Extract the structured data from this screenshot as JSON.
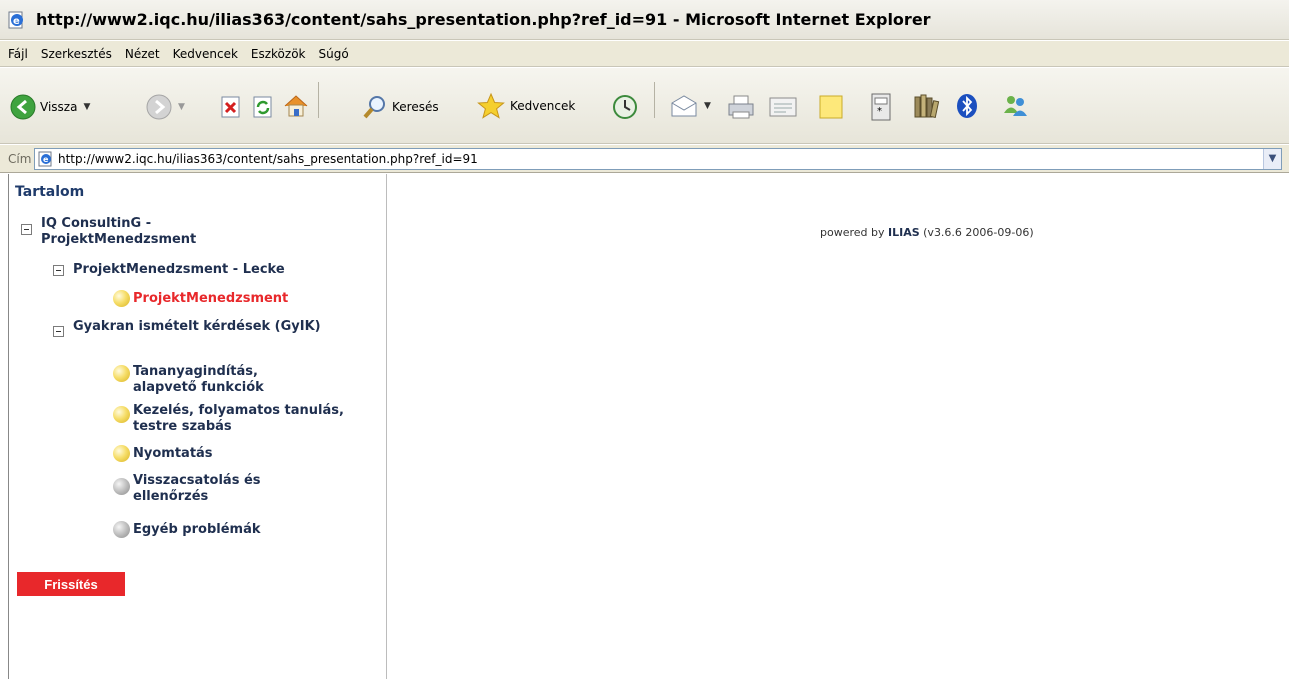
{
  "window": {
    "title": "http://www2.iqc.hu/ilias363/content/sahs_presentation.php?ref_id=91 - Microsoft Internet Explorer",
    "icon": "ie-page-icon"
  },
  "menu": {
    "items": [
      "Fájl",
      "Szerkesztés",
      "Nézet",
      "Kedvencek",
      "Eszközök",
      "Súgó"
    ]
  },
  "toolbar": {
    "back_label": "Vissza",
    "search_label": "Keresés",
    "favorites_label": "Kedvencek"
  },
  "address": {
    "label": "Cím",
    "url": "http://www2.iqc.hu/ilias363/content/sahs_presentation.php?ref_id=91"
  },
  "toc": {
    "title": "Tartalom",
    "root": "IQ ConsultinG - ProjektMenedzsment",
    "lesson": "ProjektMenedzsment - Lecke",
    "lesson_item": "ProjektMenedzsment",
    "faq": "Gyakran ismételt kérdések (GyIK)",
    "faq_items": [
      "Tananyagindítás, alapvető funkciók",
      "Kezelés, folyamatos tanulás, testre szabás",
      "Nyomtatás",
      "Visszacsatolás és ellenőrzés",
      "Egyéb problémák"
    ],
    "refresh_label": "Frissítés"
  },
  "main": {
    "powered_prefix": "powered by ",
    "powered_brand": "ILIAS",
    "powered_version": " (v3.6.6 2006-09-06)"
  },
  "colors": {
    "active_item": "#e8282b",
    "node_text": "#1f2f4f",
    "refresh_button": "#e8282b"
  }
}
